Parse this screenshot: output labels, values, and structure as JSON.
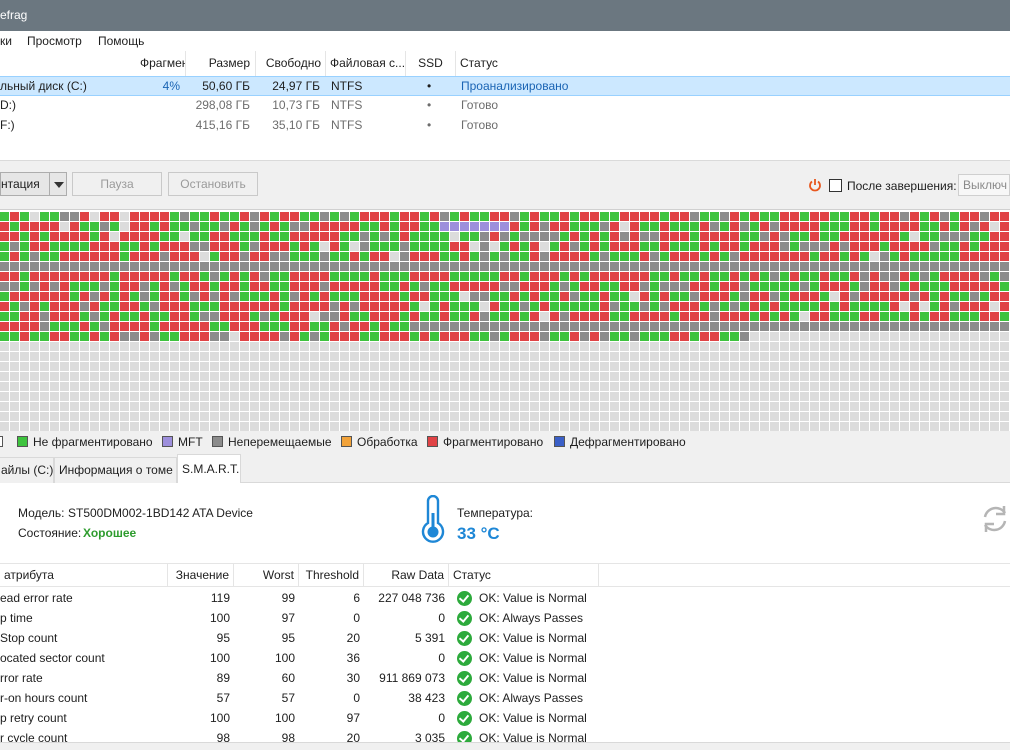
{
  "window": {
    "title": "efrag"
  },
  "menu": [
    "ки",
    "Просмотр",
    "Помощь"
  ],
  "disk_table": {
    "headers": [
      "Фрагменти...",
      "Размер",
      "Свободно",
      "Файловая с...",
      "SSD",
      "Статус"
    ],
    "rows": [
      {
        "name": "льный диск (C:)",
        "frag": "4%",
        "size": "50,60 ГБ",
        "free": "24,97 ГБ",
        "fs": "NTFS",
        "ssd": "•",
        "status": "Проанализировано"
      },
      {
        "name": "D:)",
        "frag": "",
        "size": "298,08 ГБ",
        "free": "10,73 ГБ",
        "fs": "NTFS",
        "ssd": "•",
        "status": "Готово"
      },
      {
        "name": "F:)",
        "frag": "",
        "size": "415,16 ГБ",
        "free": "35,10 ГБ",
        "fs": "NTFS",
        "ssd": "•",
        "status": "Готово"
      }
    ]
  },
  "toolbar": {
    "action_label": "нтация",
    "pause_label": "Пауза",
    "stop_label": "Остановить",
    "after_label": "После завершения:",
    "after_value": "Выключ"
  },
  "colors": {
    "not_fragmented": "#3ec33e",
    "mft": "#9d8fdc",
    "unmovable": "#8c8c8c",
    "processing": "#f2a33a",
    "fragmented": "#e04346",
    "defragmented": "#3a5fc7",
    "free": "#dcdcdc"
  },
  "legend": [
    {
      "label": "Не фрагментировано",
      "color": "#3ec33e"
    },
    {
      "label": "MFT",
      "color": "#9d8fdc"
    },
    {
      "label": "Неперемещаемые",
      "color": "#8c8c8c"
    },
    {
      "label": "Обработка",
      "color": "#f2a33a"
    },
    {
      "label": "Фрагментировано",
      "color": "#e04346"
    },
    {
      "label": "Дефрагментировано",
      "color": "#3a5fc7"
    }
  ],
  "tabs": [
    "айлы (C:)",
    "Информация о томе",
    "S.M.A.R.T."
  ],
  "smart": {
    "model_label": "Модель:",
    "model_value": "ST500DM002-1BD142 ATA Device",
    "state_label": "Состояние:",
    "state_value": "Хорошее",
    "temp_label": "Температура:",
    "temp_value": "33 °C",
    "headers": [
      "атрибута",
      "Значение",
      "Worst",
      "Threshold",
      "Raw Data",
      "Статус"
    ],
    "rows": [
      {
        "name": "ead error rate",
        "value": "119",
        "worst": "99",
        "threshold": "6",
        "raw": "227 048 736",
        "status": "OK: Value is Normal"
      },
      {
        "name": "p time",
        "value": "100",
        "worst": "97",
        "threshold": "0",
        "raw": "0",
        "status": "OK: Always Passes"
      },
      {
        "name": "Stop count",
        "value": "95",
        "worst": "95",
        "threshold": "20",
        "raw": "5 391",
        "status": "OK: Value is Normal"
      },
      {
        "name": "ocated sector count",
        "value": "100",
        "worst": "100",
        "threshold": "36",
        "raw": "0",
        "status": "OK: Value is Normal"
      },
      {
        "name": "rror rate",
        "value": "89",
        "worst": "60",
        "threshold": "30",
        "raw": "911 869 073",
        "status": "OK: Value is Normal"
      },
      {
        "name": "r-on hours count",
        "value": "57",
        "worst": "57",
        "threshold": "0",
        "raw": "38 423",
        "status": "OK: Always Passes"
      },
      {
        "name": "p retry count",
        "value": "100",
        "worst": "100",
        "threshold": "97",
        "raw": "0",
        "status": "OK: Value is Normal"
      },
      {
        "name": "r cycle count",
        "value": "98",
        "worst": "98",
        "threshold": "20",
        "raw": "3 035",
        "status": "OK: Value is Normal"
      }
    ]
  }
}
